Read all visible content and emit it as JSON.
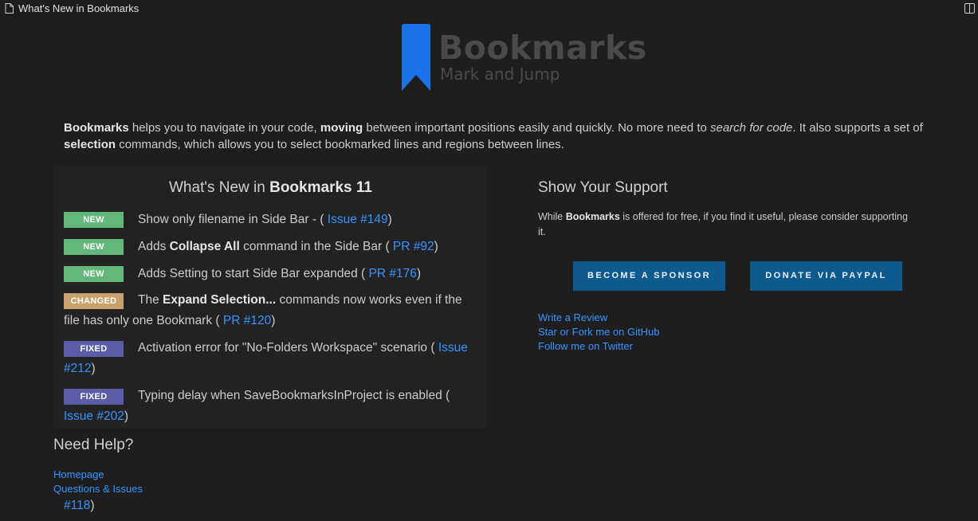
{
  "tab": {
    "title": "What's New in Bookmarks"
  },
  "logo": {
    "name": "Bookmarks",
    "tagline": "Mark and Jump",
    "color": "#1a73e8"
  },
  "intro": {
    "p1": "Bookmarks",
    "p2": " helps you to navigate in your code, ",
    "p3": "moving",
    "p4": " between important positions easily and quickly. No more need to ",
    "p5": "search for code",
    "p6": ". It also supports a set of ",
    "p7": "selection",
    "p8": " commands, which allows you to select bookmarked lines and regions between lines."
  },
  "whats_new": {
    "title_prefix": "What's New in ",
    "title_bold": "Bookmarks 11",
    "items": [
      {
        "badge": "NEW",
        "t1": "Show only filename in Side Bar - ( ",
        "link": "Issue #149",
        "t2": ")"
      },
      {
        "badge": "NEW",
        "t1": "Adds ",
        "b": "Collapse All",
        "t2": " command in the Side Bar ( ",
        "link": "PR #92",
        "t3": ")"
      },
      {
        "badge": "NEW",
        "t1": "Adds Setting to start Side Bar expanded ( ",
        "link": "PR #176",
        "t2": ")"
      },
      {
        "badge": "CHANGED",
        "t1": "The ",
        "b": "Expand Selection...",
        "t2": " commands now works even if the file has only one Bookmark ( ",
        "link": "PR #120",
        "t3": ")"
      },
      {
        "badge": "FIXED",
        "t1": "Activation error for \"No-Folders Workspace\" scenario ( ",
        "link": "Issue #212",
        "t2": ")"
      },
      {
        "badge": "FIXED",
        "t1": "Typing delay when SaveBookmarksInProject is enabled ( ",
        "link": "Issue #202",
        "t2": ")"
      }
    ]
  },
  "support": {
    "title": "Show Your Support",
    "t1": "While ",
    "b": "Bookmarks",
    "t2": " is offered for free, if you find it useful, please consider supporting it.",
    "sponsor_label": "BECOME A SPONSOR",
    "paypal_label": "DONATE VIA PAYPAL",
    "links": [
      "Write a Review",
      "Star or Fork me on GitHub",
      "Follow me on Twitter"
    ]
  },
  "help": {
    "title": "Need Help?",
    "links": [
      "Homepage",
      "Questions & Issues"
    ],
    "tail_link": "#118",
    "tail_text": ")"
  }
}
